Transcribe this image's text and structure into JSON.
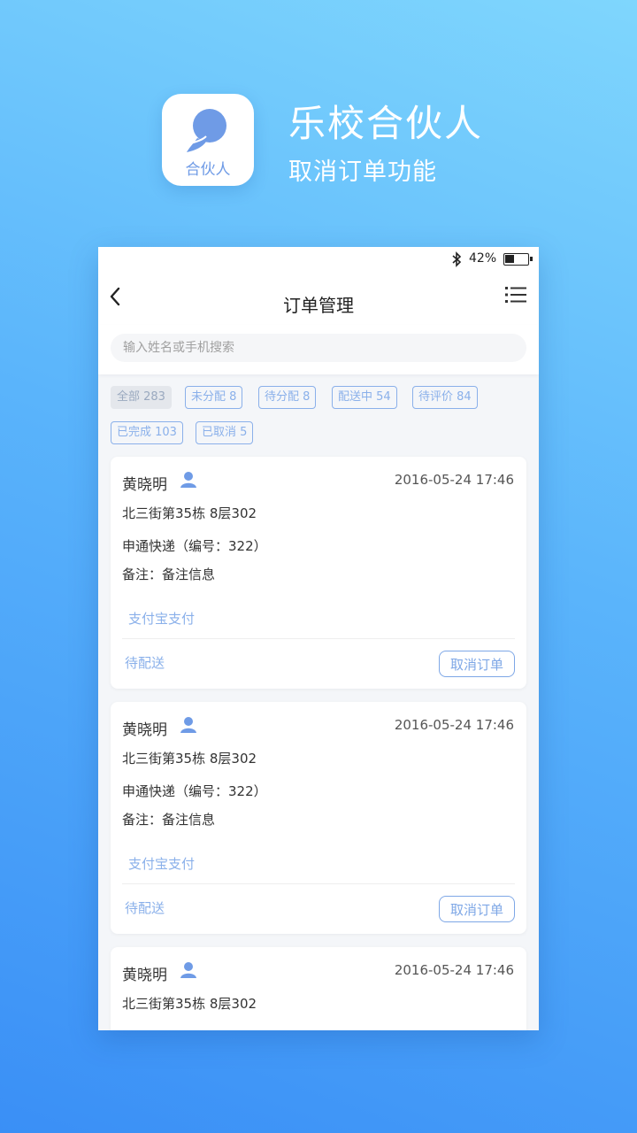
{
  "promo": {
    "icon_label": "合伙人",
    "title": "乐校合伙人",
    "subtitle": "取消订单功能"
  },
  "status_bar": {
    "battery_text": "42%",
    "battery_level": 0.42
  },
  "nav": {
    "title": "订单管理"
  },
  "search": {
    "placeholder": "输入姓名或手机搜索"
  },
  "filters": [
    {
      "label": "全部 283",
      "active": true
    },
    {
      "label": "未分配 8",
      "active": false
    },
    {
      "label": "待分配 8",
      "active": false
    },
    {
      "label": "配送中 54",
      "active": false
    },
    {
      "label": "待评价 84",
      "active": false
    },
    {
      "label": "已完成 103",
      "active": false
    },
    {
      "label": "已取消 5",
      "active": false
    }
  ],
  "orders": [
    {
      "name": "黄晓明",
      "time": "2016-05-24 17:46",
      "address": "北三街第35栋 8层302",
      "courier": "申通快递（编号：322）",
      "note": "备注：备注信息",
      "payment": "支付宝支付",
      "status": "待配送",
      "cancel_label": "取消订单"
    },
    {
      "name": "黄晓明",
      "time": "2016-05-24 17:46",
      "address": "北三街第35栋 8层302",
      "courier": "申通快递（编号：322）",
      "note": "备注：备注信息",
      "payment": "支付宝支付",
      "status": "待配送",
      "cancel_label": "取消订单"
    },
    {
      "name": "黄晓明",
      "time": "2016-05-24 17:46",
      "address": "北三街第35栋 8层302"
    }
  ],
  "colors": {
    "accent": "#7ea7e6",
    "background_top": "#7fd6fd",
    "background_bottom": "#3a8ff6"
  }
}
